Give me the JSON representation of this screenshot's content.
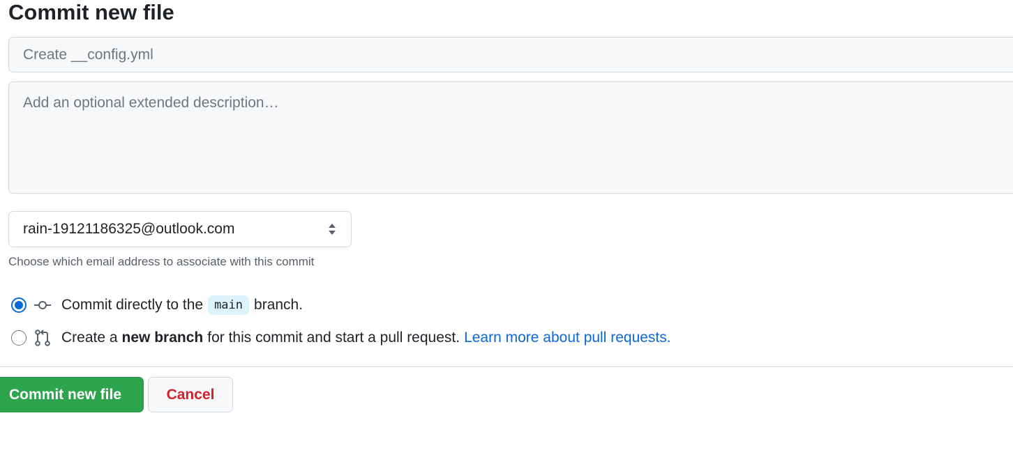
{
  "form": {
    "title": "Commit new file",
    "summary_placeholder": "Create __config.yml",
    "summary_value": "",
    "description_placeholder": "Add an optional extended description…",
    "description_value": ""
  },
  "email": {
    "selected": "rain-19121186325@outlook.com",
    "hint": "Choose which email address to associate with this commit",
    "icon": "chevron-up-down-icon"
  },
  "commit_options": {
    "direct": {
      "checked": true,
      "icon": "git-commit-icon",
      "prefix": "Commit directly to the",
      "branch": "main",
      "suffix": "branch."
    },
    "new_branch": {
      "checked": false,
      "icon": "git-pull-request-icon",
      "prefix": "Create a",
      "bold": "new branch",
      "suffix": "for this commit and start a pull request.",
      "link": "Learn more about pull requests."
    }
  },
  "actions": {
    "commit_label": "Commit new file",
    "cancel_label": "Cancel"
  },
  "colors": {
    "primary": "#2da44e",
    "accent": "#0969da",
    "danger": "#cf222e",
    "code_bg": "#ddf4ff"
  }
}
